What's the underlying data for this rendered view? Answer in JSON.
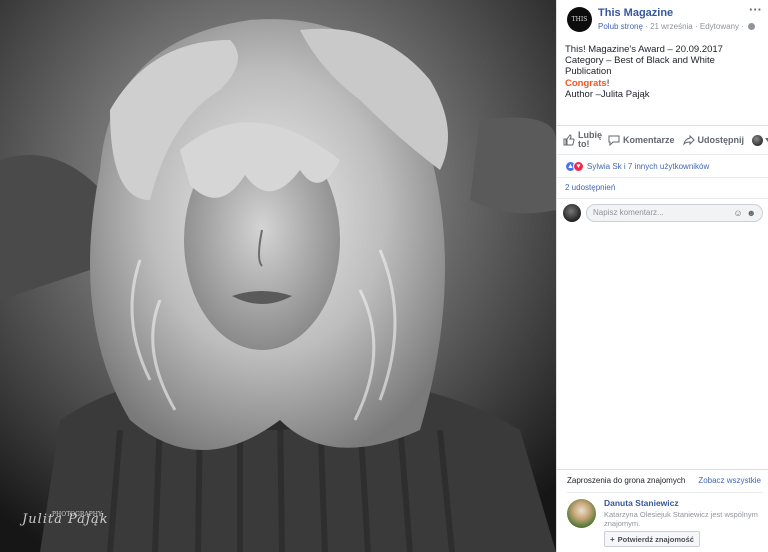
{
  "photo": {
    "signature": "Julita Pająk",
    "signature_sub": "PHOTOGRAPHY"
  },
  "post": {
    "page_name": "This Magazine",
    "avatar_text": "THIS",
    "like_page": "Polub stronę",
    "separator": "·",
    "date": "21 września",
    "edited": "Edytowany",
    "more": "···",
    "text_line1": "This! Magazine's Award – 20.09.2017",
    "text_line2": "Category – Best of Black and White Publication",
    "text_accent": "Congrats",
    "text_excl": "!",
    "text_line4": "Author –Julita Pająk"
  },
  "actions": {
    "like": "Lubię to!",
    "comment": "Komentarze",
    "share": "Udostępnij"
  },
  "reactions": {
    "summary": "Sylwia Sk i 7 innych użytkowników"
  },
  "shares": {
    "count": "2 udostępnień"
  },
  "comment": {
    "placeholder": "Napisz komentarz..."
  },
  "friends": {
    "title": "Zaproszenia do grona znajomych",
    "see_all": "Zobacz wszystkie",
    "name": "Danuta Staniewicz",
    "mutual": "Katarzyna Olesiejuk Staniewicz jest wspólnym znajomym.",
    "confirm": "Potwierdź znajomość"
  },
  "colors": {
    "link": "#365899",
    "accent": "#f55623",
    "like_blue": "#4a76e8",
    "love_red": "#f0284a"
  }
}
